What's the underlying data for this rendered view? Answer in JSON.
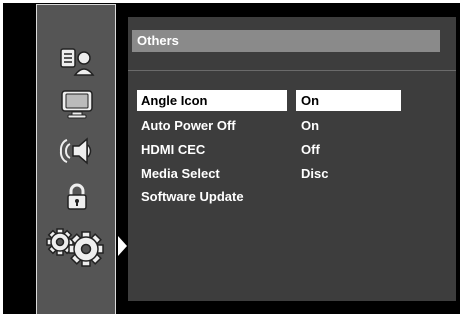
{
  "sidebar": {
    "items": [
      {
        "icon": "document-user-icon",
        "label": "Reading"
      },
      {
        "icon": "display-icon",
        "label": "Display"
      },
      {
        "icon": "speaker-audio-icon",
        "label": "Audio"
      },
      {
        "icon": "lock-icon",
        "label": "Parental"
      },
      {
        "icon": "gears-icon",
        "label": "Others"
      }
    ],
    "selected_index": 4
  },
  "panel": {
    "title": "Others"
  },
  "menu": {
    "rows": [
      {
        "label": "Angle Icon",
        "value": "On"
      },
      {
        "label": "Auto Power Off",
        "value": "On"
      },
      {
        "label": "HDMI CEC",
        "value": "Off"
      },
      {
        "label": "Media Select",
        "value": "Disc"
      },
      {
        "label": "Software Update",
        "value": ""
      }
    ],
    "selected_index": 0
  },
  "colors": {
    "background": "#000000",
    "panel": "#3d3d3d",
    "sidebar": "#555555",
    "header": "#8a8a8a",
    "highlight": "#ffffff"
  }
}
